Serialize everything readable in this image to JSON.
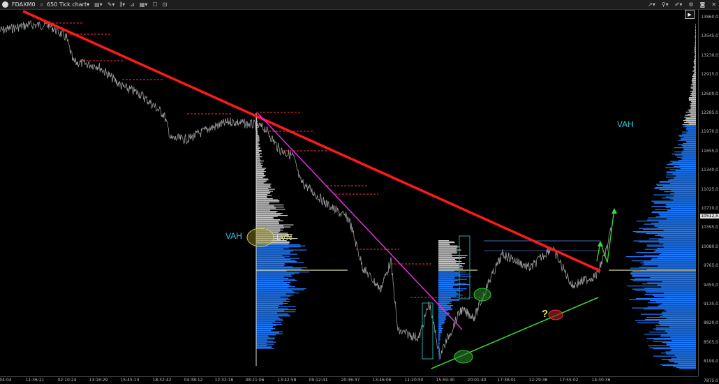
{
  "toolbar": {
    "symbol": "FDAXM0",
    "chart_type": "650 Tick chart",
    "left_icons": [
      "search-icon",
      "dropdown-icon",
      "bar-style-icon",
      "drawing-icon",
      "indicators-icon",
      "strategy-icon",
      "template-icon",
      "window-icon",
      "fullscreen-icon"
    ],
    "right_icons": [
      "cursor-icon",
      "link-icon",
      "brush-icon",
      "settings-icon",
      "camera-icon",
      "close-icon"
    ]
  },
  "corner_button": {
    "label": "▶"
  },
  "axis": {
    "y_labels": [
      "13860,0",
      "13545,0",
      "13230,0",
      "12915,0",
      "12600,0",
      "12285,0",
      "11970,0",
      "11655,0",
      "11340,0",
      "11025,0",
      "10710,0",
      "10395,0",
      "10080,0",
      "9765,0",
      "9450,0",
      "9135,0",
      "8820,0",
      "8505,0",
      "8190,0",
      "7875,0"
    ],
    "current_price": "10512,5",
    "x_labels": [
      "04:04",
      "11:36:21",
      "02:10:24",
      "13:16:29",
      "15:45:10",
      "18:32:42",
      "04:38:12",
      "12:32:16",
      "08:21:06",
      "13:42:58",
      "09:12:41",
      "20:36:37",
      "13:46:06",
      "11:20:50",
      "15:59:30",
      "20:01:40",
      "17:36:01",
      "12:29:36",
      "17:55:02",
      "14:30:36"
    ]
  },
  "annotations": {
    "vah_left": "VAH",
    "lvn": "LVN",
    "vah_right": "VAH",
    "question": "?"
  },
  "colors": {
    "trendline": "#ff1a1a",
    "magenta_line": "#e62ee6",
    "support_line": "#33dd33",
    "volume_profile": "#1e7bff",
    "volume_gray": "#c8c8c8",
    "poc": "#d8d8a0",
    "annotation_cyan": "#36c8e0",
    "annotation_yellow": "#e6e64a"
  }
}
